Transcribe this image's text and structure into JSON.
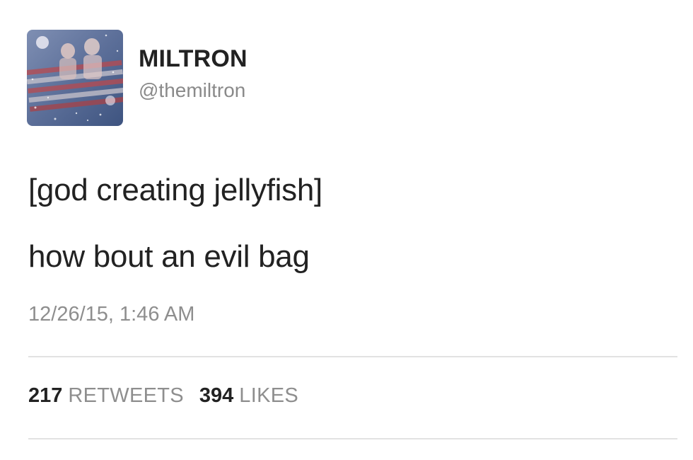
{
  "tweet": {
    "display_name": "MILTRON",
    "handle": "@themiltron",
    "text_lines": [
      "[god creating jellyfish]",
      "how bout an evil bag"
    ],
    "timestamp": "12/26/15, 1:46 AM",
    "retweets": {
      "count": "217",
      "label": "RETWEETS"
    },
    "likes": {
      "count": "394",
      "label": "LIKES"
    }
  },
  "colors": {
    "name_text": "#222222",
    "secondary_text": "#8e8e8e",
    "divider": "#e2e2e2",
    "background": "#ffffff"
  },
  "icons": {
    "avatar": "profile-photo-flag-collage"
  }
}
